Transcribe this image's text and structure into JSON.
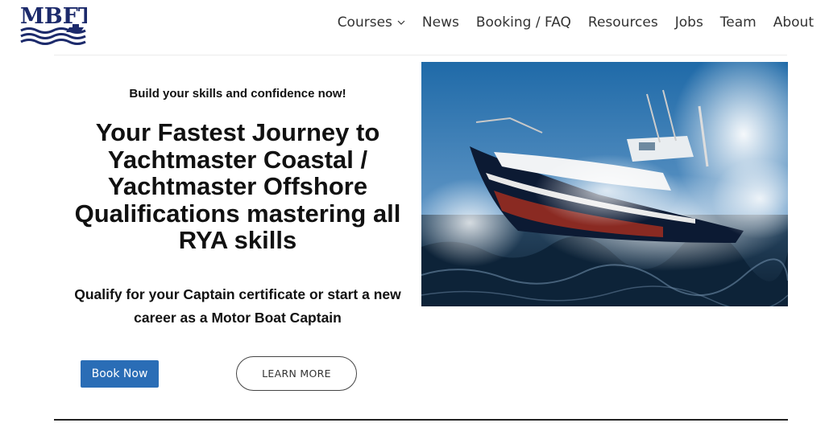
{
  "brand": {
    "logo_text": "MBFT"
  },
  "nav": {
    "items": [
      {
        "label": "Courses",
        "has_dropdown": true
      },
      {
        "label": "News"
      },
      {
        "label": "Booking / FAQ"
      },
      {
        "label": "Resources"
      },
      {
        "label": "Jobs"
      },
      {
        "label": "Team"
      },
      {
        "label": "About"
      }
    ]
  },
  "hero": {
    "tagline": "Build your skills and confidence now!",
    "title": "Your Fastest Journey to Yachtmaster Coastal / Yachtmaster Offshore Qualifications mastering all RYA skills",
    "subtitle": "Qualify for your Captain certificate or start a new career as a Motor Boat Captain",
    "book_label": "Book Now",
    "learn_label": "LEARN MORE"
  },
  "colors": {
    "accent": "#2a6db6",
    "logo": "#1c2a6b"
  }
}
